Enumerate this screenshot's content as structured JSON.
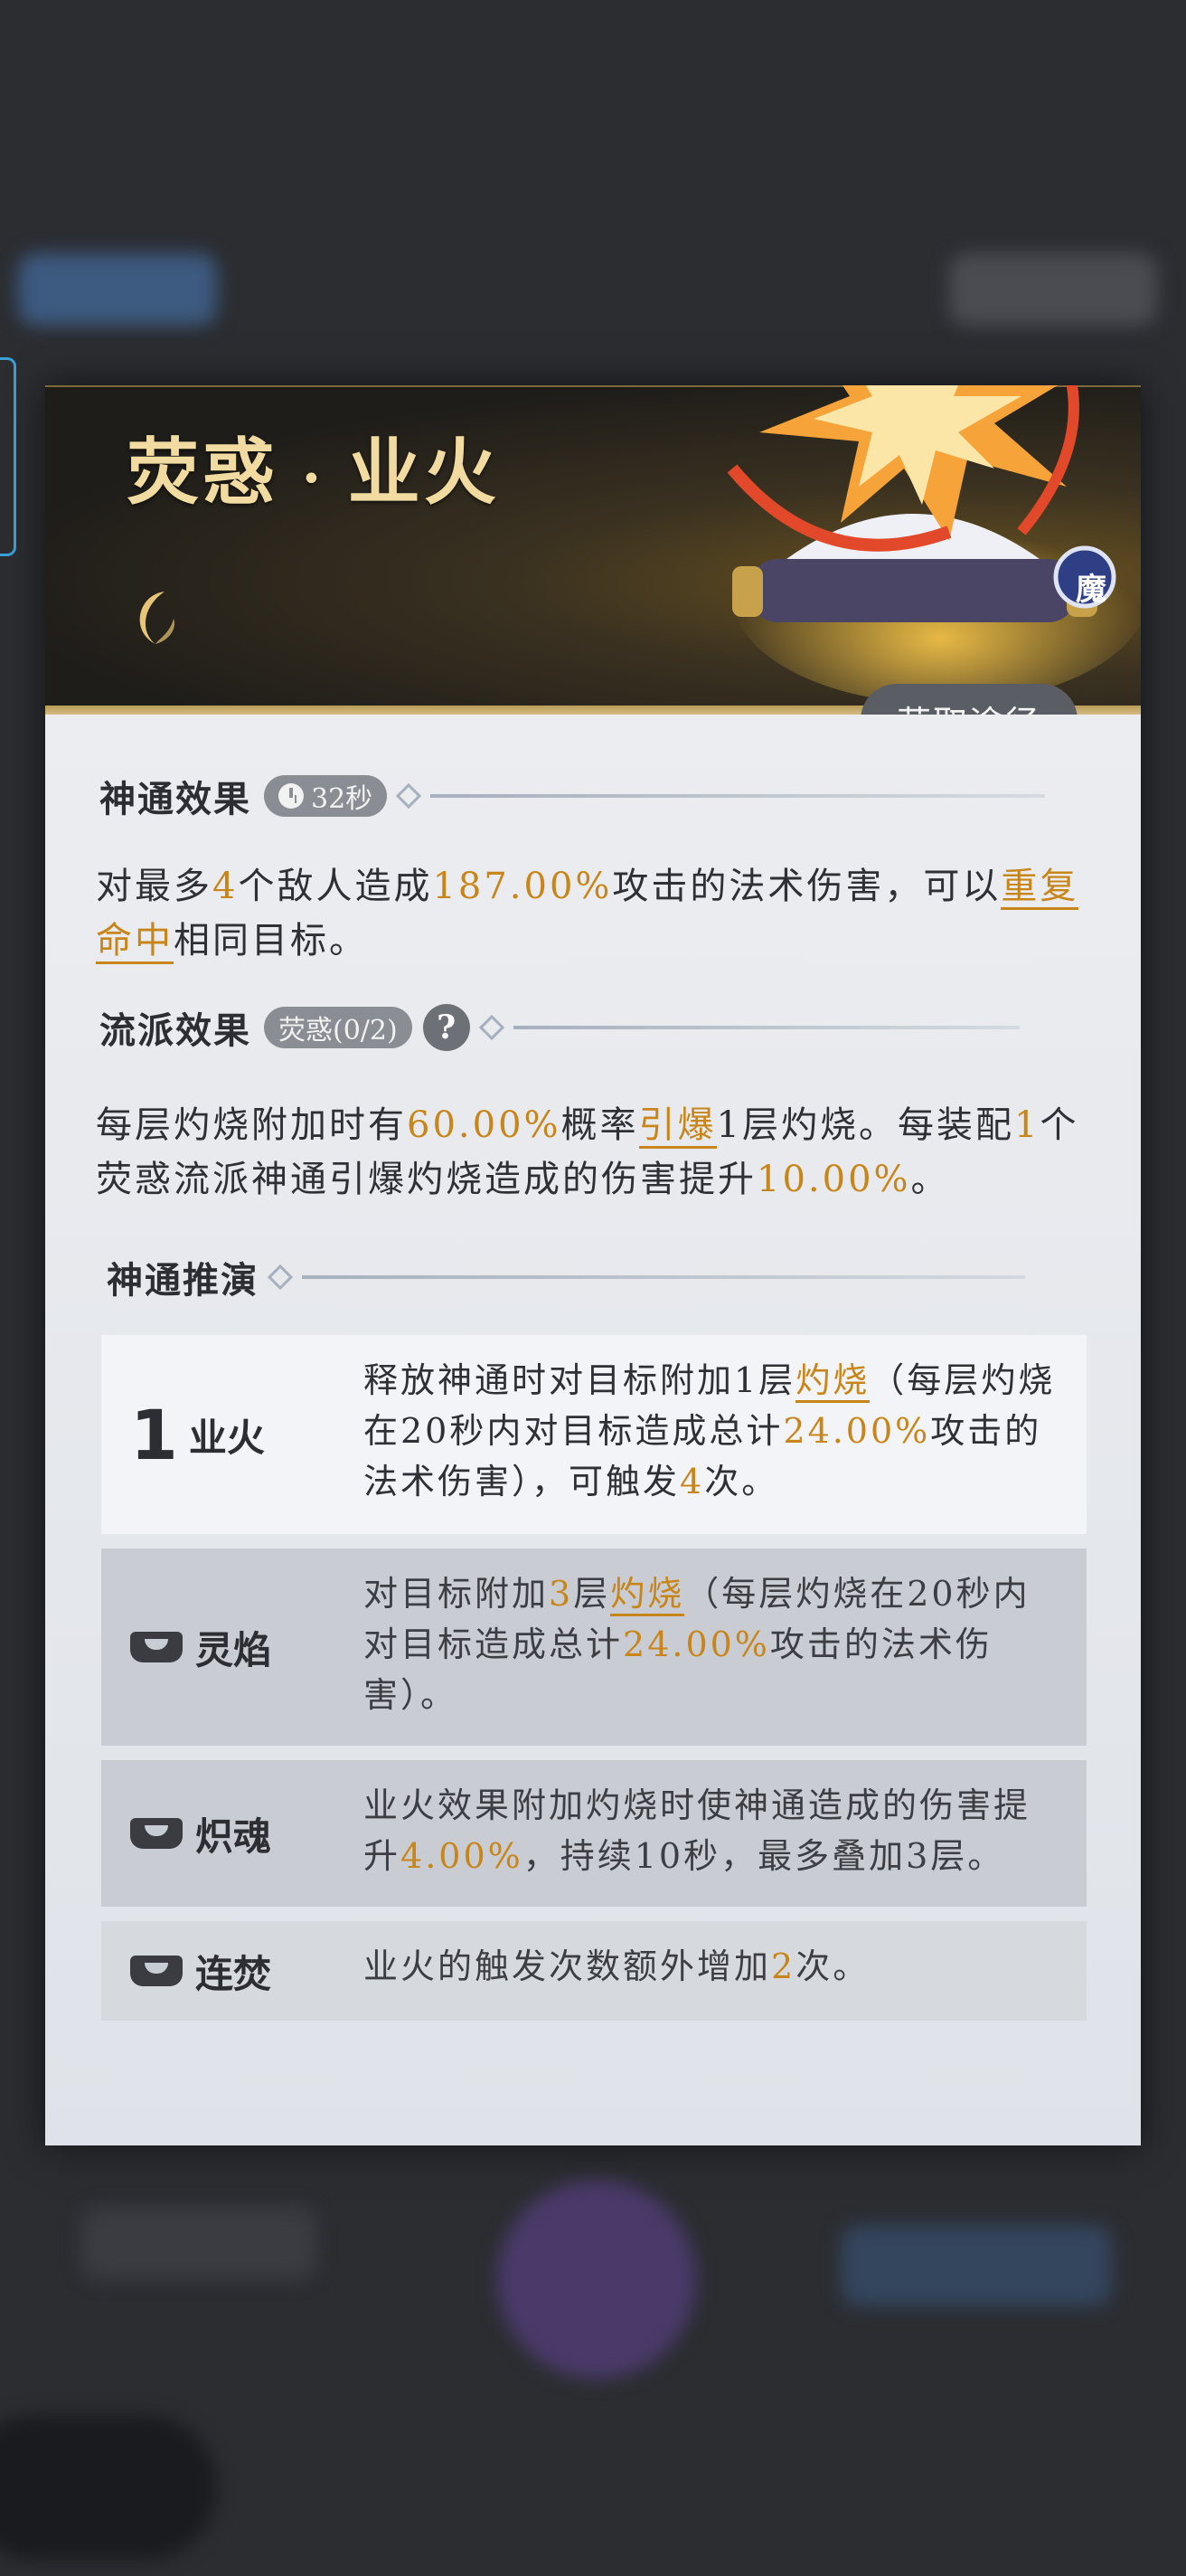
{
  "card": {
    "title_main": "荧惑",
    "title_sep": "·",
    "title_sub": "业火",
    "type_badge": "魔",
    "source_button": "获取途径"
  },
  "effect": {
    "title": "神通效果",
    "cooldown": "32秒",
    "text_1": "对最多",
    "targets": "4",
    "text_2": "个敌人造成",
    "damage": "187.00%",
    "text_3": "攻击的法术伤害，可以",
    "keyword": "重复命中",
    "text_4": "相同目标。"
  },
  "school": {
    "title": "流派效果",
    "badge": "荧惑(0/2)",
    "help": "?",
    "text_1": "每层灼烧附加时有",
    "chance": "60.00%",
    "text_2": "概率",
    "keyword": "引爆",
    "text_3": "1层灼烧。每装配",
    "count": "1",
    "text_4": "个荧惑流派神通引爆灼烧造成的伤害提升",
    "bonus": "10.00%",
    "text_5": "。"
  },
  "evolution": {
    "title": "神通推演",
    "items": [
      {
        "num": "1",
        "name": "业火",
        "t1": "释放神通时对目标附加1层",
        "kw": "灼烧",
        "t2": "（每层灼烧在20秒内对目标造成总计",
        "v1": "24.00%",
        "t3": "攻击的法术伤害），可触发",
        "v2": "4",
        "t4": "次。"
      },
      {
        "name": "灵焰",
        "t1": "对目标附加",
        "v1": "3",
        "t2": "层",
        "kw": "灼烧",
        "t3": "（每层灼烧在20秒内对目标造成总计",
        "v2": "24.00%",
        "t4": "攻击的法术伤害）。"
      },
      {
        "name": "炽魂",
        "t1": "业火效果附加灼烧时使神通造成的伤害提升",
        "v1": "4.00%",
        "t2": "，持续10秒，最多叠加3层。"
      },
      {
        "name": "连焚",
        "t1": "业火的触发次数额外增加",
        "v1": "2",
        "t2": "次。"
      }
    ]
  }
}
